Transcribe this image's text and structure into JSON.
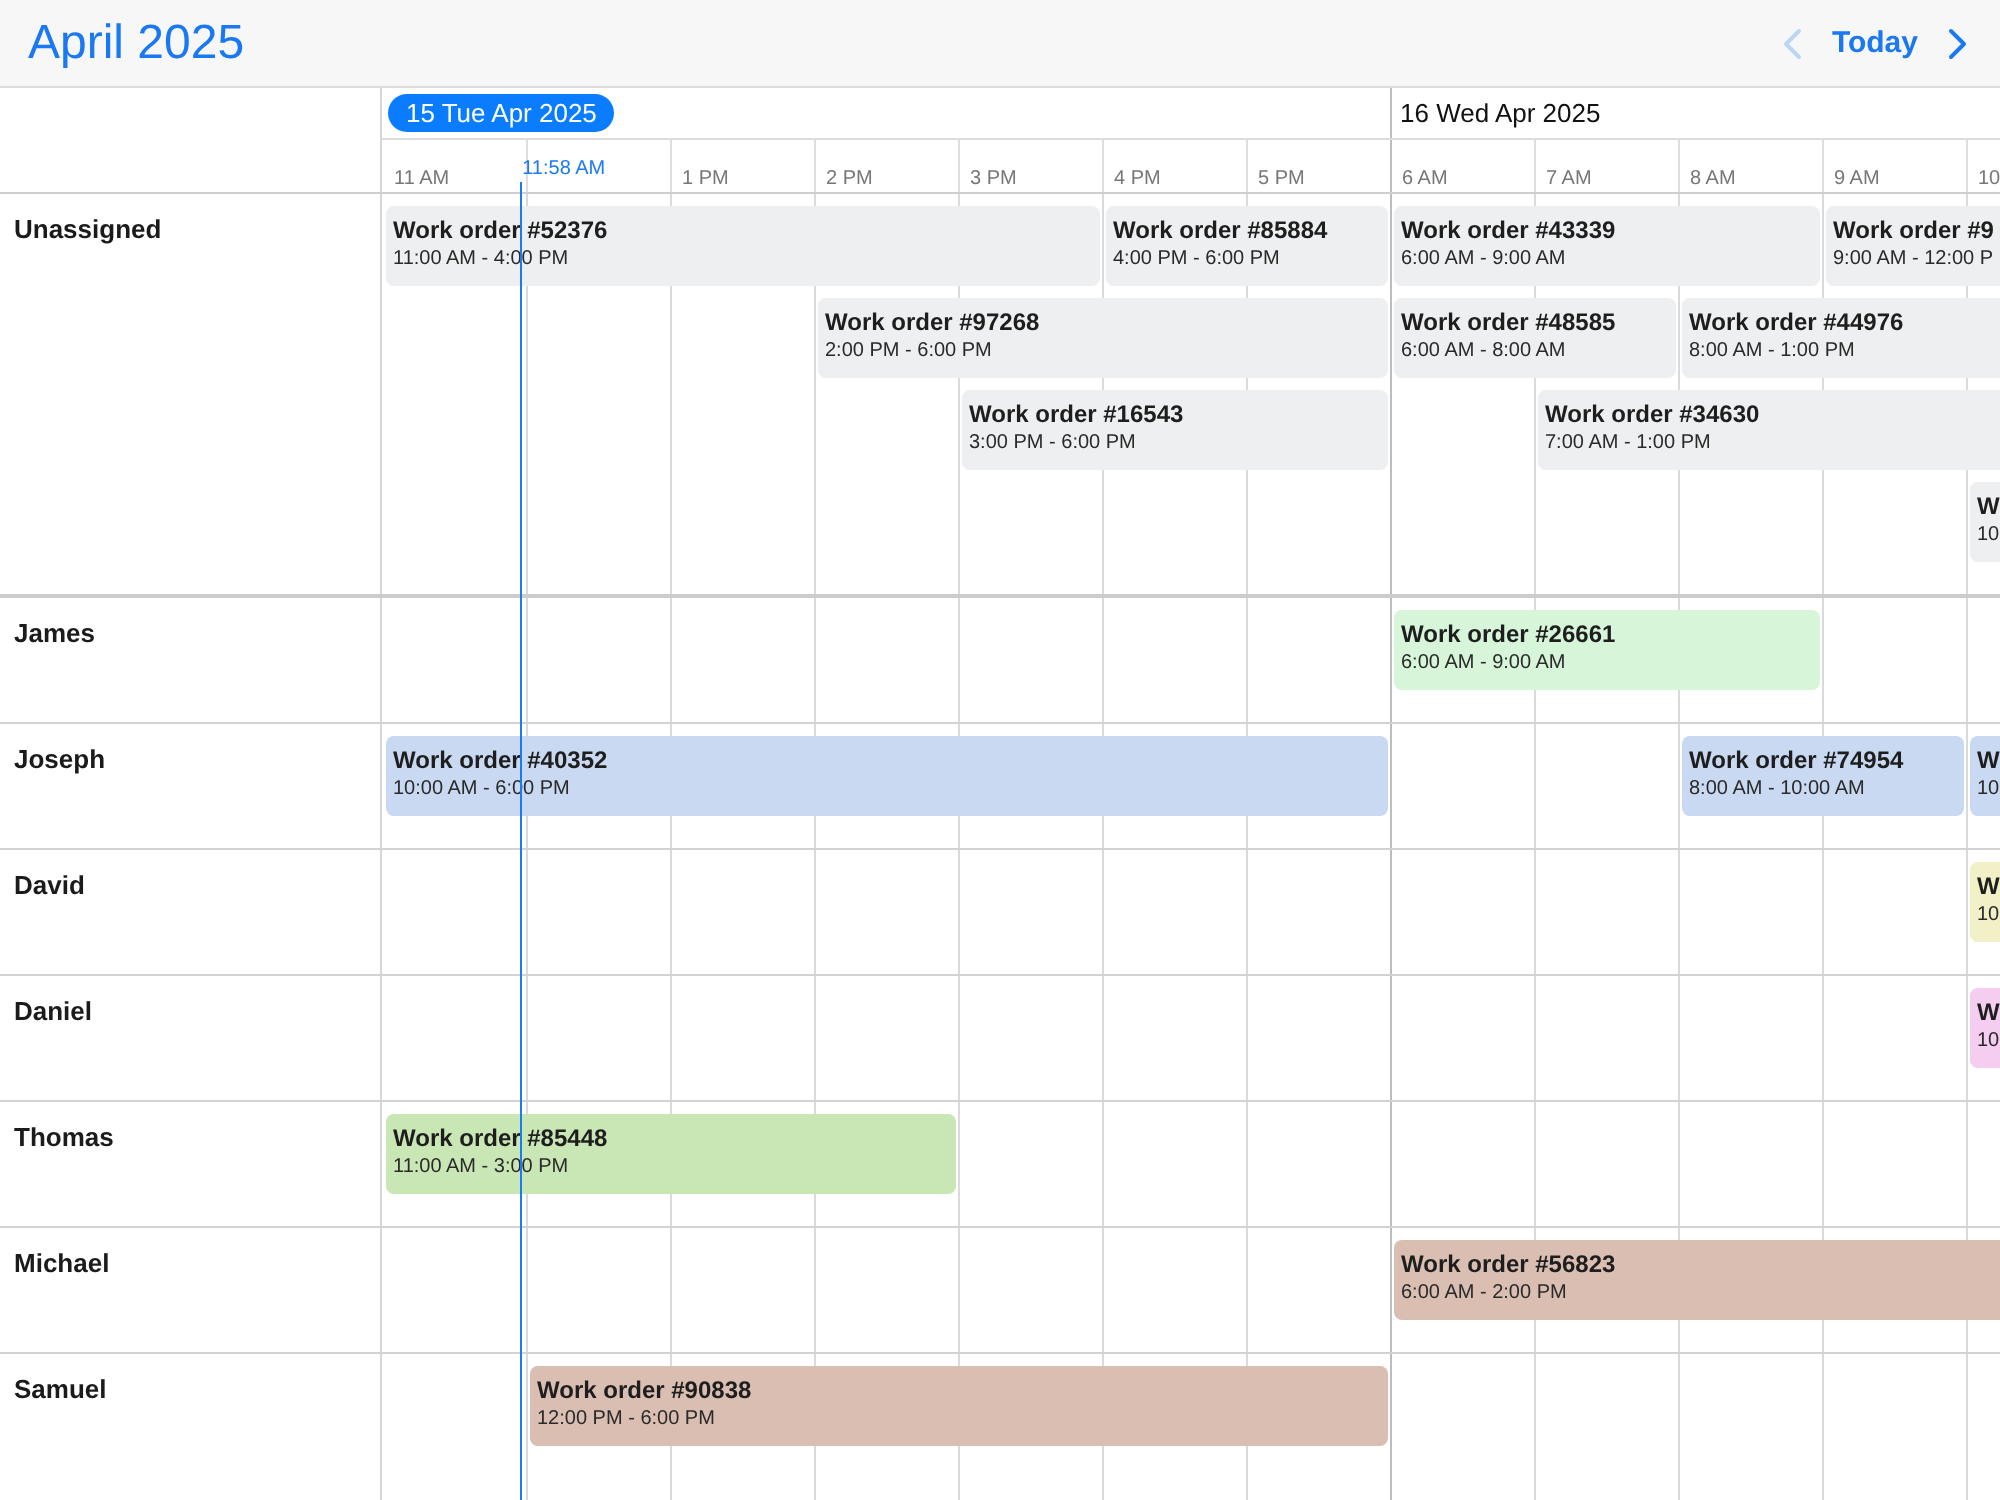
{
  "header": {
    "title": "April 2025",
    "prev": {
      "disabled": true
    },
    "today": "Today",
    "next": {
      "disabled": false
    }
  },
  "days": [
    {
      "label": "15 Tue Apr 2025",
      "selected": true,
      "hours": [
        "11 AM",
        "1 PM",
        "2 PM",
        "3 PM",
        "4 PM",
        "5 PM"
      ]
    },
    {
      "label": "16 Wed Apr 2025",
      "selected": false,
      "hours": [
        "6 AM",
        "7 AM",
        "8 AM",
        "9 AM",
        "10"
      ]
    }
  ],
  "now": {
    "label": "11:58 AM"
  },
  "resources": [
    {
      "name": "Unassigned",
      "kind": "unassigned",
      "color": "#eeeff1",
      "events": [
        {
          "title": "Work order #52376",
          "time": "11:00 AM - 4:00 PM",
          "next_day": false
        },
        {
          "title": "Work order #85884",
          "time": "4:00 PM - 6:00 PM",
          "next_day": false
        },
        {
          "title": "Work order #43339",
          "time": "6:00 AM - 9:00 AM",
          "next_day": true
        },
        {
          "title": "Work order #9",
          "time": "9:00 AM - 12:00 P",
          "next_day": true
        },
        {
          "title": "Work order #97268",
          "time": "2:00 PM - 6:00 PM",
          "next_day": false
        },
        {
          "title": "Work order #48585",
          "time": "6:00 AM - 8:00 AM",
          "next_day": true
        },
        {
          "title": "Work order #44976",
          "time": "8:00 AM - 1:00 PM",
          "next_day": true
        },
        {
          "title": "Work order #16543",
          "time": "3:00 PM - 6:00 PM",
          "next_day": false
        },
        {
          "title": "Work order #34630",
          "time": "7:00 AM - 1:00 PM",
          "next_day": true
        },
        {
          "title": "W",
          "time": "10",
          "next_day": true
        }
      ]
    },
    {
      "name": "James",
      "kind": "technician",
      "color": "#d6f5d9",
      "events": [
        {
          "title": "Work order #26661",
          "time": "6:00 AM - 9:00 AM",
          "next_day": true
        }
      ]
    },
    {
      "name": "Joseph",
      "kind": "technician",
      "color": "#c8d9f1",
      "events": [
        {
          "title": "Work order #40352",
          "time": "10:00 AM - 6:00 PM",
          "next_day": false
        },
        {
          "title": "Work order #74954",
          "time": "8:00 AM - 10:00 AM",
          "next_day": true
        },
        {
          "title": "W",
          "time": "10",
          "next_day": true
        }
      ]
    },
    {
      "name": "David",
      "kind": "technician",
      "color": "#f2f0c6",
      "events": [
        {
          "title": "W",
          "time": "10",
          "next_day": true
        }
      ]
    },
    {
      "name": "Daniel",
      "kind": "technician",
      "color": "#f5cdf0",
      "events": [
        {
          "title": "W",
          "time": "10",
          "next_day": true
        }
      ]
    },
    {
      "name": "Thomas",
      "kind": "technician",
      "color": "#c9e7b5",
      "events": [
        {
          "title": "Work order #85448",
          "time": "11:00 AM - 3:00 PM",
          "next_day": false
        }
      ]
    },
    {
      "name": "Michael",
      "kind": "technician",
      "color": "#d9beb1",
      "events": [
        {
          "title": "Work order #56823",
          "time": "6:00 AM - 2:00 PM",
          "next_day": true
        }
      ]
    },
    {
      "name": "Samuel",
      "kind": "technician",
      "color": "#d9beb1",
      "events": [
        {
          "title": "Work order #90838",
          "time": "12:00 PM - 6:00 PM",
          "next_day": false
        }
      ]
    }
  ]
}
